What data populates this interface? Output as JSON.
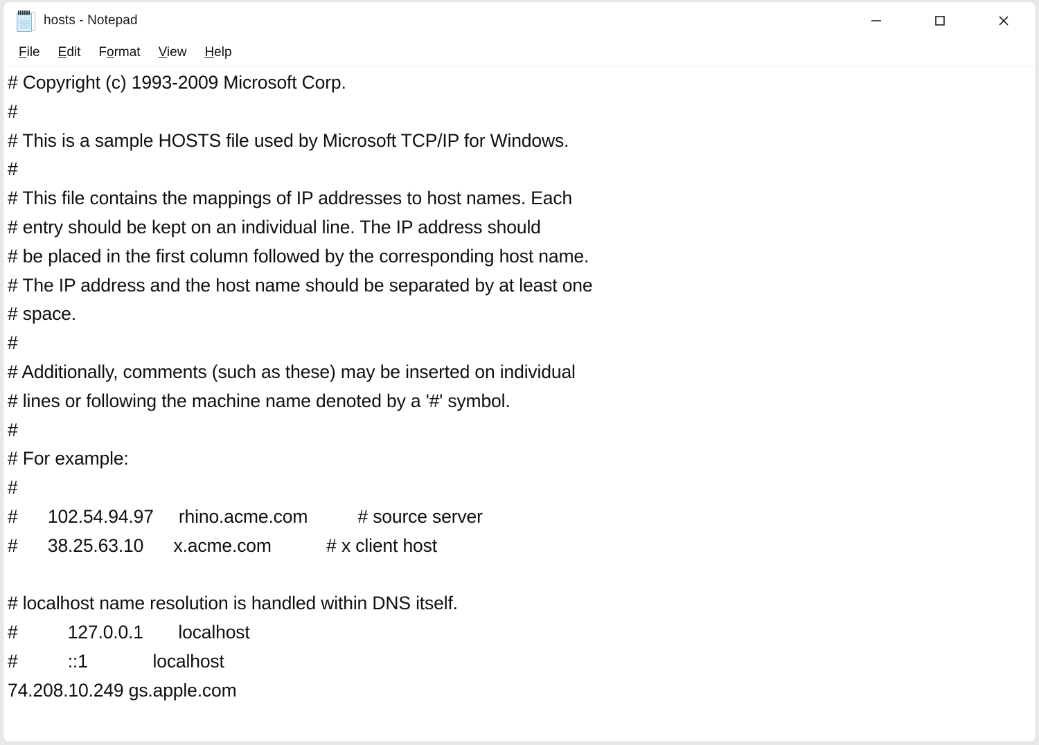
{
  "window": {
    "title": "hosts - Notepad",
    "icon": "notepad-icon",
    "controls": {
      "minimize": "—",
      "maximize": "□",
      "close": "✕"
    }
  },
  "menu": {
    "items": [
      {
        "label": "File",
        "accesskey": "F",
        "before": "",
        "after": "ile"
      },
      {
        "label": "Edit",
        "accesskey": "E",
        "before": "",
        "after": "dit"
      },
      {
        "label": "Format",
        "accesskey": "o",
        "before": "F",
        "after": "rmat"
      },
      {
        "label": "View",
        "accesskey": "V",
        "before": "",
        "after": "iew"
      },
      {
        "label": "Help",
        "accesskey": "H",
        "before": "",
        "after": "elp"
      }
    ]
  },
  "editor": {
    "filename": "hosts",
    "lines": [
      "# Copyright (c) 1993-2009 Microsoft Corp.",
      "#",
      "# This is a sample HOSTS file used by Microsoft TCP/IP for Windows.",
      "#",
      "# This file contains the mappings of IP addresses to host names. Each",
      "# entry should be kept on an individual line. The IP address should",
      "# be placed in the first column followed by the corresponding host name.",
      "# The IP address and the host name should be separated by at least one",
      "# space.",
      "#",
      "# Additionally, comments (such as these) may be inserted on individual",
      "# lines or following the machine name denoted by a '#' symbol.",
      "#",
      "# For example:",
      "#",
      "#      102.54.94.97     rhino.acme.com          # source server",
      "#      38.25.63.10      x.acme.com           # x client host",
      "",
      "# localhost name resolution is handled within DNS itself.",
      "#          127.0.0.1       localhost",
      "#          ::1             localhost",
      "74.208.10.249 gs.apple.com"
    ]
  },
  "colors": {
    "window_background": "#ffffff",
    "desktop_background": "#e8e8e8",
    "text": "#0f0f0f",
    "title_text": "#1a1a1a",
    "menu_border": "#eeeeee",
    "close_hover": "#e81123"
  }
}
